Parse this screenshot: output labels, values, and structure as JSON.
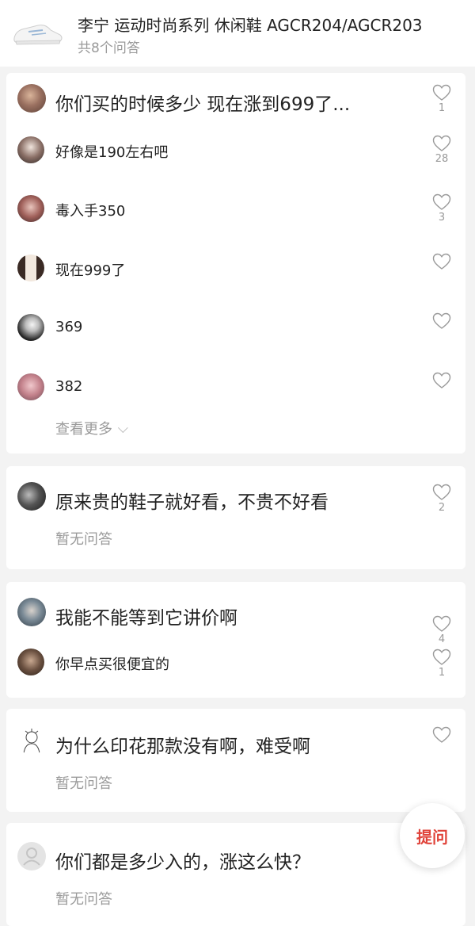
{
  "header": {
    "product_title": "李宁 运动时尚系列 休闲鞋 AGCR204/AGCR203",
    "question_count": "共8个问答"
  },
  "questions": [
    {
      "text": "你们买的时候多少 现在涨到699了...",
      "likes": "1",
      "answers": [
        {
          "text": "好像是190左右吧",
          "likes": "28"
        },
        {
          "text": "毒入手350",
          "likes": "3"
        },
        {
          "text": "现在999了",
          "likes": ""
        },
        {
          "text": "369",
          "likes": ""
        },
        {
          "text": "382",
          "likes": ""
        }
      ],
      "more_label": "查看更多"
    },
    {
      "text": "原来贵的鞋子就好看，不贵不好看",
      "likes": "2",
      "empty_label": "暂无问答"
    },
    {
      "text": "我能不能等到它讲价啊",
      "likes": "4",
      "answers": [
        {
          "text": "你早点买很便宜的",
          "likes": "1"
        }
      ]
    },
    {
      "text": "为什么印花那款没有啊，难受啊",
      "likes": "",
      "empty_label": "暂无问答"
    },
    {
      "text": "你们都是多少入的，涨这么快？",
      "likes": "",
      "empty_label": "暂无问答"
    }
  ],
  "ask_button_label": "提问",
  "icons": {
    "like": "heart-outline-icon",
    "more": "chevron-down-icon"
  },
  "colors": {
    "accent": "#e0433a",
    "muted_text": "#9a9a9a",
    "background": "#f3f3f3"
  }
}
